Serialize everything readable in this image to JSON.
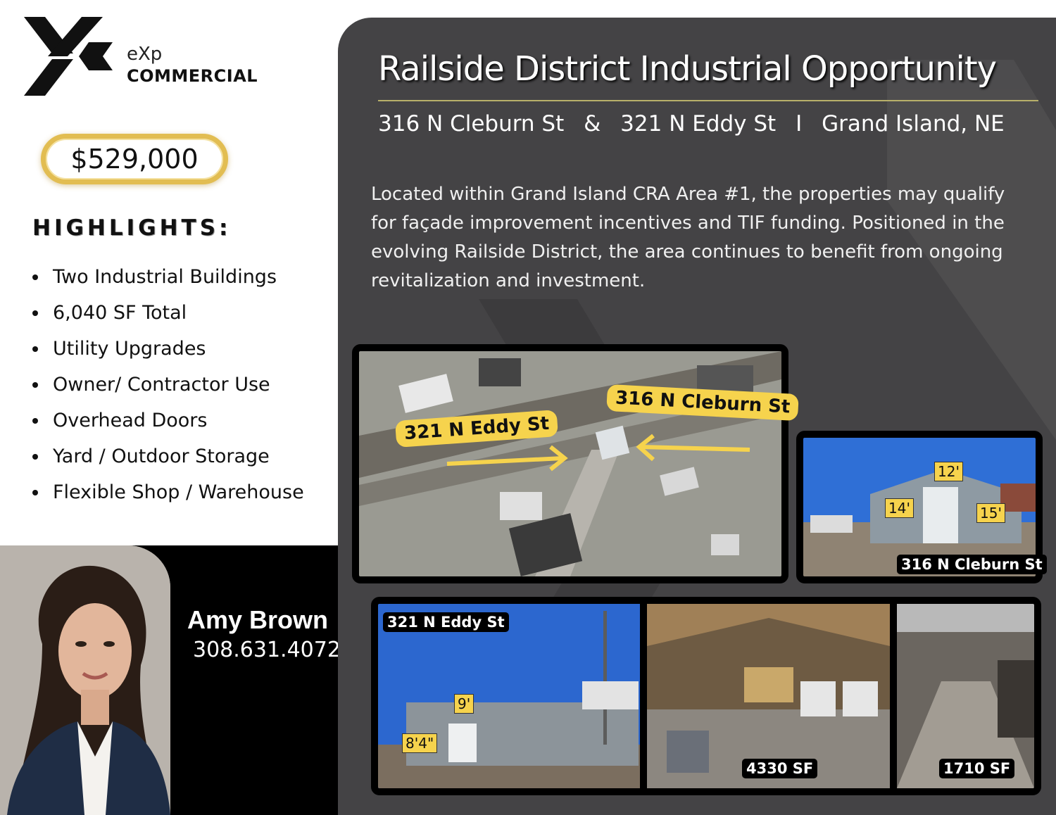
{
  "brand": {
    "line1": "eXp",
    "line2": "COMMERCIAL"
  },
  "price": "$529,000",
  "highlights": {
    "title": "HIGHLIGHTS:",
    "items": [
      "Two Industrial Buildings",
      "6,040 SF Total",
      "Utility Upgrades",
      "Owner/ Contractor Use",
      "Overhead Doors",
      "Yard / Outdoor Storage",
      "Flexible Shop / Warehouse"
    ]
  },
  "agent": {
    "name": "Amy Brown",
    "phone": "308.631.4072"
  },
  "listing": {
    "title": "Railside District Industrial Opportunity",
    "address_1": "316 N Cleburn St",
    "amp": "&",
    "address_2": "321 N Eddy St",
    "sep": "I",
    "city": "Grand Island, NE",
    "description": "Located within Grand Island CRA Area #1, the properties may qualify for façade improvement incentives and TIF funding. Positioned in the evolving Railside District, the area continues to benefit from ongoing revitalization and investment."
  },
  "map": {
    "label_eddy": "321 N Eddy St",
    "label_cleburn": "316 N Cleburn St"
  },
  "photos": {
    "cleburn": {
      "label": "316 N Cleburn St",
      "dim_top": "12'",
      "dim_left": "14'",
      "dim_right": "15'"
    },
    "eddy": {
      "label": "321 N Eddy St",
      "dim_top": "9'",
      "dim_left": "8'4\""
    },
    "interior_1": {
      "label": "4330 SF"
    },
    "interior_2": {
      "label": "1710 SF"
    }
  }
}
